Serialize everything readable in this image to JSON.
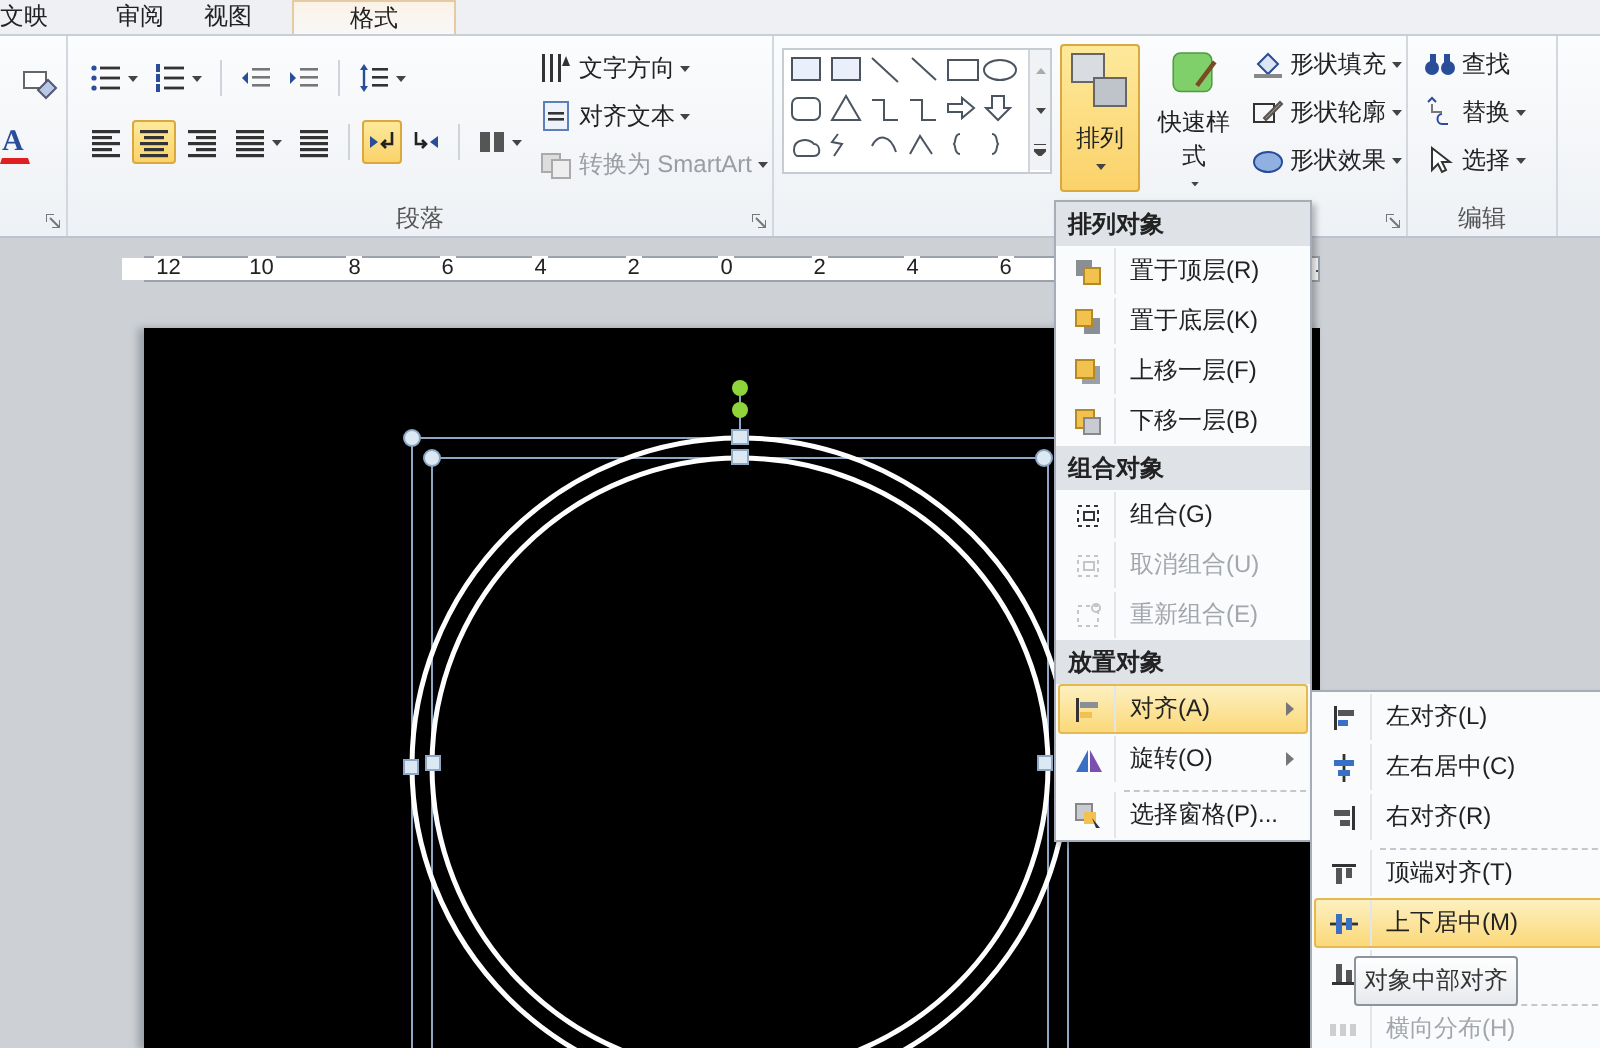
{
  "tabs": [
    {
      "label": "文映",
      "selected": false
    },
    {
      "label": "审阅",
      "selected": false
    },
    {
      "label": "视图",
      "selected": false
    },
    {
      "label": "格式",
      "selected": true
    }
  ],
  "ribbon": {
    "font_group": {
      "font_color_glyph": "A"
    },
    "paragraph_group": {
      "label": "段落",
      "align_buttons": [
        {
          "selected": false
        },
        {
          "selected": true
        },
        {
          "selected": false
        },
        {
          "selected": false
        },
        {
          "selected": false
        }
      ],
      "direction_buttons": [
        {
          "selected": true
        },
        {
          "selected": false
        }
      ],
      "commands": [
        {
          "label": "文字方向",
          "disabled": false
        },
        {
          "label": "对齐文本",
          "disabled": false
        },
        {
          "label": "转换为 SmartArt",
          "disabled": true
        }
      ]
    },
    "drawing_group": {
      "arrange_button": {
        "label": "排列",
        "selected": true
      },
      "quick_styles": {
        "label": "快速样式"
      },
      "commands": [
        {
          "label": "形状填充"
        },
        {
          "label": "形状轮廓"
        },
        {
          "label": "形状效果"
        }
      ]
    },
    "editing_group": {
      "label": "编辑",
      "commands": [
        {
          "label": "查找",
          "dropdown": false
        },
        {
          "label": "替换",
          "dropdown": true
        },
        {
          "label": "选择",
          "dropdown": true
        }
      ]
    }
  },
  "ruler": {
    "labels": [
      "12",
      "10",
      "8",
      "6",
      "4",
      "2",
      "0",
      "2",
      "4",
      "6"
    ]
  },
  "arrange_menu": {
    "sections": [
      {
        "header": "排列对象",
        "items": [
          {
            "label": "置于顶层(R)",
            "disabled": false,
            "selected": false,
            "submenu": false,
            "separator_before": false
          },
          {
            "label": "置于底层(K)",
            "disabled": false,
            "selected": false,
            "submenu": false,
            "separator_before": false
          },
          {
            "label": "上移一层(F)",
            "disabled": false,
            "selected": false,
            "submenu": false,
            "separator_before": false
          },
          {
            "label": "下移一层(B)",
            "disabled": false,
            "selected": false,
            "submenu": false,
            "separator_before": false
          }
        ]
      },
      {
        "header": "组合对象",
        "items": [
          {
            "label": "组合(G)",
            "disabled": false,
            "selected": false,
            "submenu": false,
            "separator_before": false
          },
          {
            "label": "取消组合(U)",
            "disabled": true,
            "selected": false,
            "submenu": false,
            "separator_before": false
          },
          {
            "label": "重新组合(E)",
            "disabled": true,
            "selected": false,
            "submenu": false,
            "separator_before": false
          }
        ]
      },
      {
        "header": "放置对象",
        "items": [
          {
            "label": "对齐(A)",
            "disabled": false,
            "selected": true,
            "submenu": true,
            "separator_before": false
          },
          {
            "label": "旋转(O)",
            "disabled": false,
            "selected": false,
            "submenu": true,
            "separator_before": false
          },
          {
            "label": "选择窗格(P)...",
            "disabled": false,
            "selected": false,
            "submenu": false,
            "separator_before": true
          }
        ]
      }
    ]
  },
  "align_submenu": {
    "items": [
      {
        "label": "左对齐(L)",
        "disabled": false,
        "selected": false,
        "separator_before": false
      },
      {
        "label": "左右居中(C)",
        "disabled": false,
        "selected": false,
        "separator_before": false
      },
      {
        "label": "右对齐(R)",
        "disabled": false,
        "selected": false,
        "separator_before": false
      },
      {
        "label": "顶端对齐(T)",
        "disabled": false,
        "selected": false,
        "separator_before": true
      },
      {
        "label": "上下居中(M)",
        "disabled": false,
        "selected": true,
        "separator_before": false
      },
      {
        "disabled": false,
        "selected": false,
        "separator_before": false
      },
      {
        "label": "横向分布(H)",
        "disabled": true,
        "selected": false,
        "separator_before": true
      }
    ]
  },
  "tooltip": {
    "text": "对象中部对齐"
  }
}
